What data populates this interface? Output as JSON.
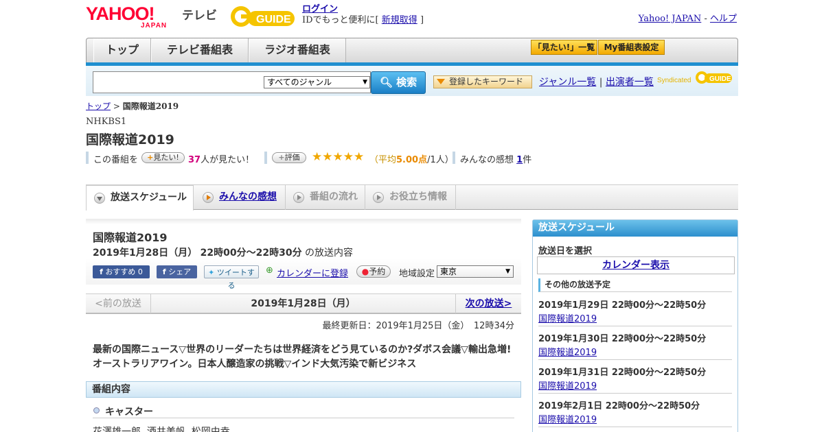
{
  "header": {
    "logo_yahoo": "YAHOO!",
    "logo_japan": "JAPAN",
    "logo_tv": "テレビ",
    "login_link": "ログイン",
    "login_text": "IDでもっと便利に[",
    "register_link": "新規取得",
    "register_close": "]",
    "yahoo_japan_link": "Yahoo! JAPAN",
    "separator": "-",
    "help_link": "ヘルプ"
  },
  "nav": {
    "tabs": [
      {
        "label": "トップ"
      },
      {
        "label": "テレビ番組表"
      },
      {
        "label": "ラジオ番組表"
      }
    ],
    "mitai_list": "「見たい!」一覧",
    "my_schedule": "My番組表設定"
  },
  "search": {
    "input_value": "",
    "genre_selected": "すべてのジャンル",
    "search_button": "検索",
    "keyword_button": "登録したキーワード",
    "genre_list": "ジャンル一覧",
    "divider": "|",
    "performer_list": "出演者一覧",
    "syndicated": "Syndicated"
  },
  "breadcrumb": {
    "top": "トップ",
    "separator": ">",
    "current": "国際報道2019"
  },
  "program": {
    "channel": "NHKBS1",
    "title": "国際報道2019",
    "kono_bangumi": "この番組を",
    "mitai_button": "見たい!",
    "mitai_count": "37",
    "mitai_suffix": "人が見たい！",
    "eval_button": "評価",
    "stars": "★★★★★",
    "rating_open": "（平均",
    "rating_avg": "5.00点",
    "rating_people": "/1人）",
    "comments_label": "みんなの感想",
    "comments_count": "1",
    "comments_suffix": "件"
  },
  "subtabs": [
    {
      "label": "放送スケジュール",
      "state": "active"
    },
    {
      "label": "みんなの感想",
      "state": "link"
    },
    {
      "label": "番組の流れ",
      "state": "disabled"
    },
    {
      "label": "お役立ち情報",
      "state": "disabled"
    }
  ],
  "broadcast": {
    "title": "国際報道2019",
    "date": "2019年1月28日（月）",
    "time": "22時00分～22時30分",
    "suffix": "の放送内容",
    "recommend_button": "おすすめ",
    "recommend_count": "0",
    "share_button": "シェア",
    "tweet_button": "ツイートする",
    "calendar_link": "カレンダーに登録",
    "reserve_button": "予約",
    "region_label": "地域設定",
    "region_selected": "東京",
    "prev": "<前の放送",
    "current_date": "2019年1月28日（月）",
    "next": "次の放送>",
    "updated": "最終更新日：2019年1月25日（金）　12時34分",
    "description": "最新の国際ニュース▽世界のリーダーたちは世界経済をどう見ているのか?ダボス会議▽輸出急増!オーストラリアワイン。日本人醸造家の挑戦▽インド大気汚染で新ビジネス",
    "content_header": "番組内容",
    "caster_label": "キャスター",
    "casters": "花澤雄一郎, 酒井美帆, 松岡由幸"
  },
  "sidebar": {
    "header": "放送スケジュール",
    "date_select_label": "放送日を選択",
    "calendar_button": "カレンダー表示",
    "other_label": "その他の放送予定",
    "schedule": [
      {
        "datetime": "2019年1月29日  22時00分～22時50分",
        "title": "国際報道2019"
      },
      {
        "datetime": "2019年1月30日  22時00分～22時50分",
        "title": "国際報道2019"
      },
      {
        "datetime": "2019年1月31日  22時00分～22時50分",
        "title": "国際報道2019"
      },
      {
        "datetime": "2019年2月1日  22時00分～22時50分",
        "title": "国際報道2019"
      }
    ]
  },
  "colors": {
    "accent_blue": "#1e8fd0",
    "yahoo_red": "#ff0033",
    "gguide_yellow": "#f5c400",
    "star": "#f0a700",
    "pink": "#d1007b"
  }
}
